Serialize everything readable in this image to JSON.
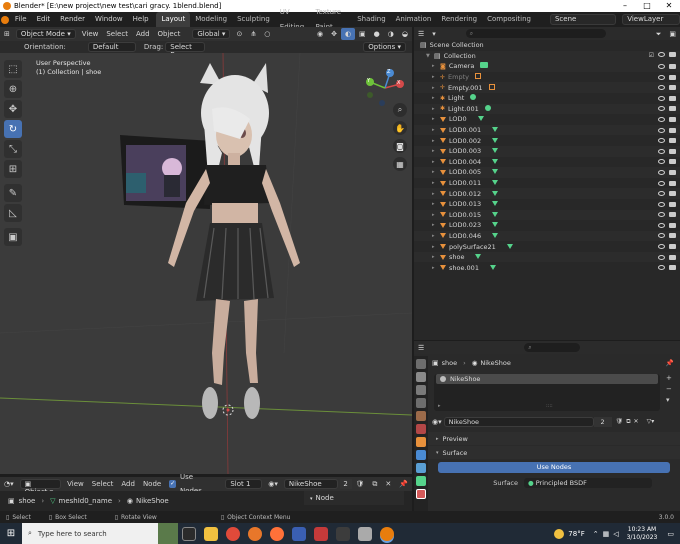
{
  "window": {
    "title": "Blender* [E:\\new project\\new test\\cari gracy. 1blend.blend]"
  },
  "menu": {
    "items": [
      "File",
      "Edit",
      "Render",
      "Window",
      "Help"
    ],
    "workspaces": [
      "Layout",
      "Modeling",
      "Sculpting",
      "UV Editing",
      "Texture Paint",
      "Shading",
      "Animation",
      "Rendering",
      "Compositing"
    ],
    "scene": "Scene",
    "view_layer": "ViewLayer"
  },
  "viewport_header": {
    "mode": "Object Mode",
    "menus": [
      "View",
      "Select",
      "Add",
      "Object"
    ],
    "transform": "Global",
    "orientation_label": "Orientation:",
    "orientation_value": "Default",
    "drag_label": "Drag:",
    "drag_value": "Select Box",
    "options": "Options"
  },
  "viewport": {
    "view_name": "User Perspective",
    "collection_info": "(1) Collection | shoe",
    "gizmo": {
      "x": "X",
      "y": "Y",
      "z": "Z"
    }
  },
  "outliner": {
    "root": "Scene Collection",
    "collection": "Collection",
    "items": [
      {
        "name": "Camera",
        "icon": "camera-icon"
      },
      {
        "name": "Empty",
        "icon": "empty-icon"
      },
      {
        "name": "Empty.001",
        "icon": "empty-icon"
      },
      {
        "name": "Light",
        "icon": "light-icon"
      },
      {
        "name": "Light.001",
        "icon": "light-icon"
      },
      {
        "name": "LOD0",
        "icon": "mesh-icon"
      },
      {
        "name": "LOD0.001",
        "icon": "mesh-icon"
      },
      {
        "name": "LOD0.002",
        "icon": "mesh-icon"
      },
      {
        "name": "LOD0.003",
        "icon": "mesh-icon"
      },
      {
        "name": "LOD0.004",
        "icon": "mesh-icon"
      },
      {
        "name": "LOD0.005",
        "icon": "mesh-icon"
      },
      {
        "name": "LOD0.011",
        "icon": "mesh-icon"
      },
      {
        "name": "LOD0.012",
        "icon": "mesh-icon"
      },
      {
        "name": "LOD0.013",
        "icon": "mesh-icon"
      },
      {
        "name": "LOD0.015",
        "icon": "mesh-icon"
      },
      {
        "name": "LOD0.023",
        "icon": "mesh-icon"
      },
      {
        "name": "LOD0.046",
        "icon": "mesh-icon"
      },
      {
        "name": "polySurface21",
        "icon": "mesh-icon"
      },
      {
        "name": "shoe",
        "icon": "mesh-icon"
      },
      {
        "name": "shoe.001",
        "icon": "mesh-icon"
      }
    ]
  },
  "properties": {
    "breadcrumb_object": "shoe",
    "breadcrumb_material": "NikeShoe",
    "material_slot": "NikeShoe",
    "material_name": "NikeShoe",
    "user_count": "2",
    "preview_label": "Preview",
    "surface_label": "Surface",
    "use_nodes": "Use Nodes",
    "surface_field_label": "Surface",
    "surface_value": "Principled BSDF"
  },
  "node_editor": {
    "mode": "Object",
    "menus": [
      "View",
      "Select",
      "Add",
      "Node"
    ],
    "use_nodes": "Use Nodes",
    "slot": "Slot 1",
    "material": "NikeShoe",
    "users": "2",
    "breadcrumb": [
      "shoe",
      "meshId0_name",
      "NikeShoe"
    ],
    "panel_tab": "Node"
  },
  "statusbar": {
    "select": "Select",
    "box_select": "Box Select",
    "rotate_view": "Rotate View",
    "context_menu": "Object Context Menu",
    "version": "3.0.0"
  },
  "taskbar": {
    "search_placeholder": "Type here to search",
    "weather": "78°F",
    "time": "10:23 AM",
    "date": "3/10/2023"
  },
  "colors": {
    "accent": "#4772b3",
    "orange": "#e87d0d",
    "green_axis": "#6ec23a",
    "red_axis": "#d44a4a",
    "blue_axis": "#4a8bd4"
  }
}
